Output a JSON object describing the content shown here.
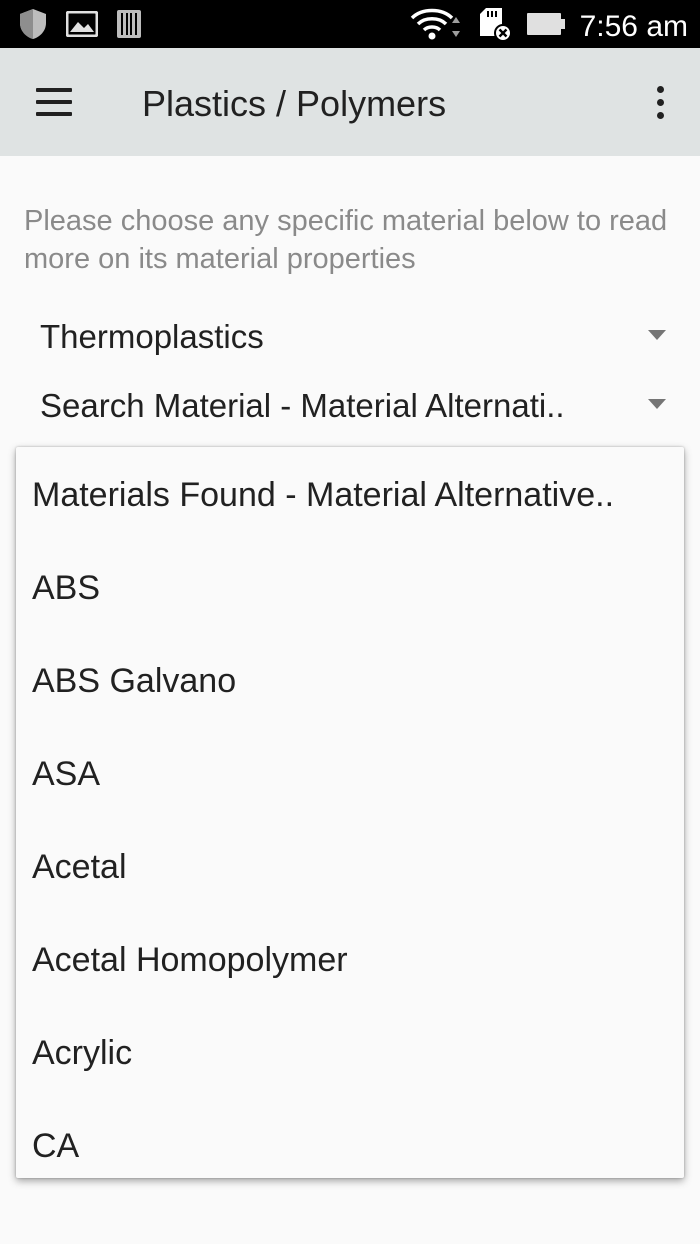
{
  "status_bar": {
    "time": "7:56 am",
    "icons": [
      "shield-icon",
      "image-icon",
      "barcode-icon",
      "wifi-icon",
      "sd-card-icon",
      "battery-icon"
    ]
  },
  "toolbar": {
    "title": "Plastics / Polymers",
    "menu_icon": "hamburger-menu-icon",
    "overflow_icon": "more-vert-icon"
  },
  "content": {
    "intro": "Please choose any specific material below to read more on its material properties",
    "category_spinner": "Thermoplastics",
    "search_spinner": "Search Material - Material Alternati.."
  },
  "dropdown": {
    "items": [
      "Materials Found - Material Alternative..",
      "ABS",
      "ABS Galvano",
      "ASA",
      "Acetal",
      "Acetal Homopolymer",
      "Acrylic",
      "CA"
    ]
  },
  "colors": {
    "status_bar": "#000000",
    "toolbar": "#dfe3e3",
    "background": "#fafafa",
    "primary_text": "#212121",
    "secondary_text": "#8a8a8a"
  }
}
